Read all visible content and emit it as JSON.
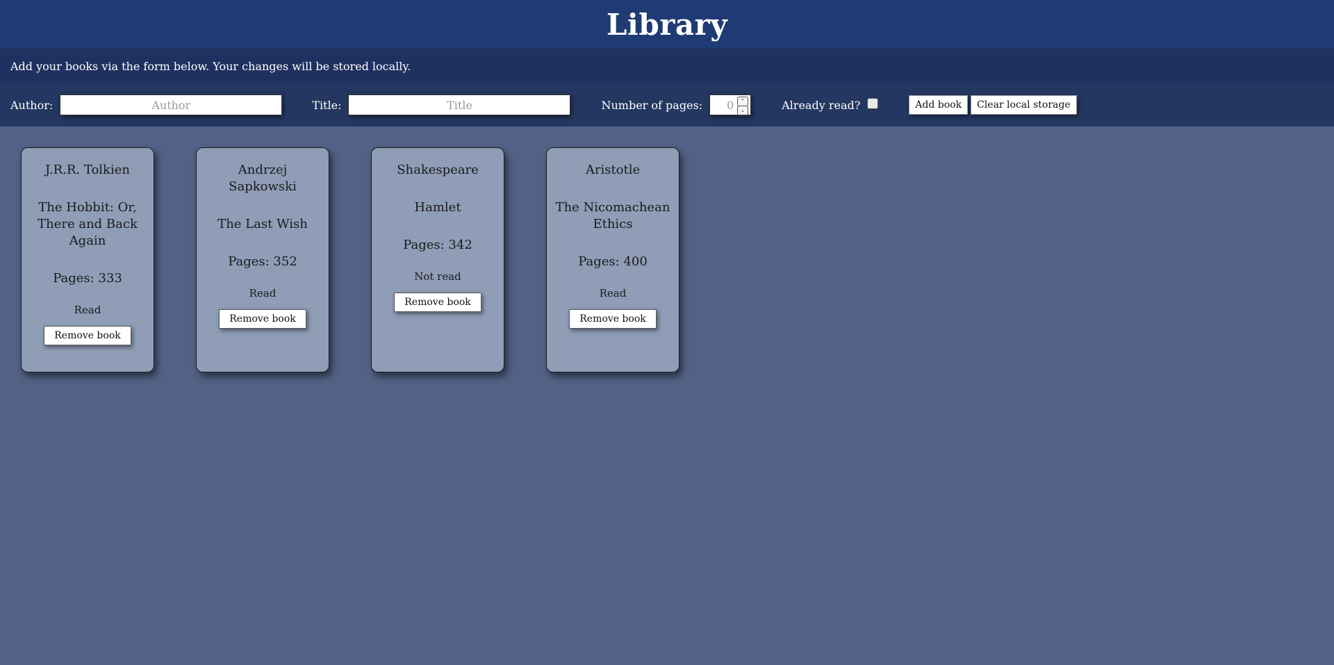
{
  "header": {
    "title": "Library"
  },
  "info": {
    "text": "Add your books via the form below. Your changes will be stored locally."
  },
  "form": {
    "author_label": "Author:",
    "author_placeholder": "Author",
    "title_label": "Title:",
    "title_placeholder": "Title",
    "pages_label": "Number of pages:",
    "pages_value": "0",
    "read_label": "Already read?",
    "read_checked": false,
    "add_button": "Add book",
    "clear_button": "Clear local storage"
  },
  "books": [
    {
      "author": "J.R.R. Tolkien",
      "title": "The Hobbit: Or, There and Back Again",
      "pages": "Pages: 333",
      "status": "Read",
      "remove": "Remove book"
    },
    {
      "author": "Andrzej Sapkowski",
      "title": "The Last Wish",
      "pages": "Pages: 352",
      "status": "Read",
      "remove": "Remove book"
    },
    {
      "author": "Shakespeare",
      "title": "Hamlet",
      "pages": "Pages: 342",
      "status": "Not read",
      "remove": "Remove book"
    },
    {
      "author": "Aristotle",
      "title": "The Nicomachean Ethics",
      "pages": "Pages: 400",
      "status": "Read",
      "remove": "Remove book"
    }
  ],
  "colors": {
    "header_bg": "#1f3b73",
    "info_bg": "#1f3160",
    "form_bg": "#243760",
    "page_bg": "#526285",
    "card_bg": "#8f9db7"
  }
}
